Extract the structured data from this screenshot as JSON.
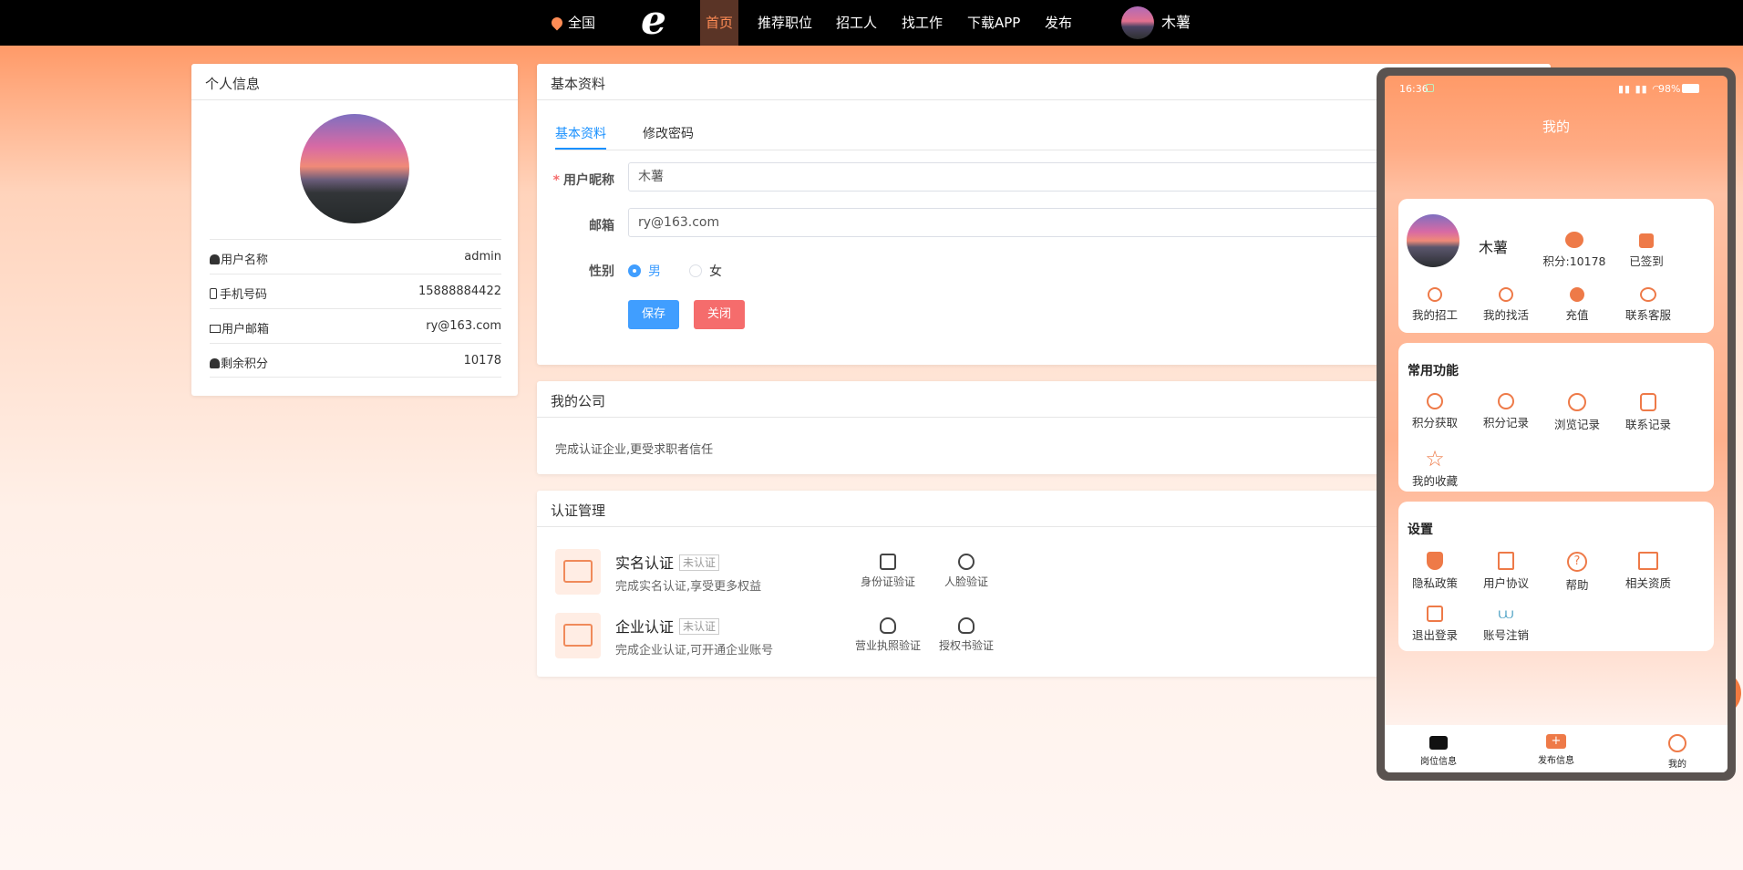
{
  "topnav": {
    "location": "全国",
    "logo": "e",
    "items": [
      "首页",
      "推荐职位",
      "招工人",
      "找工作",
      "下载APP",
      "发布"
    ],
    "active_index": 0,
    "username": "木薯"
  },
  "personal_info": {
    "title": "个人信息",
    "rows": [
      {
        "label": "用户名称",
        "value": "admin",
        "icon": "user-icon"
      },
      {
        "label": "手机号码",
        "value": "15888884422",
        "icon": "phone-icon"
      },
      {
        "label": "用户邮箱",
        "value": "ry@163.com",
        "icon": "mail-icon"
      },
      {
        "label": "剩余积分",
        "value": "10178",
        "icon": "user-icon"
      }
    ]
  },
  "basic_info": {
    "title": "基本资料",
    "tabs": [
      "基本资料",
      "修改密码"
    ],
    "nickname_label": "用户昵称",
    "nickname_value": "木薯",
    "email_label": "邮箱",
    "email_value": "ry@163.com",
    "gender_label": "性别",
    "gender_options": [
      "男",
      "女"
    ],
    "gender_selected": "男",
    "save_label": "保存",
    "close_label": "关闭",
    "save_color": "#409eff",
    "close_color": "#f56c6c"
  },
  "company": {
    "title": "我的公司",
    "text": "完成认证企业,更受求职者信任"
  },
  "cert": {
    "title": "认证管理",
    "items": [
      {
        "name": "实名认证",
        "status": "未认证",
        "desc": "完成实名认证,享受更多权益",
        "actions": [
          "身份证验证",
          "人脸验证"
        ]
      },
      {
        "name": "企业认证",
        "status": "未认证",
        "desc": "完成企业认证,可开通企业账号",
        "actions": [
          "营业执照验证",
          "授权书验证"
        ]
      }
    ]
  },
  "phone": {
    "time": "16:36",
    "battery": "98%",
    "title": "我的",
    "username": "木薯",
    "points_label": "积分:10178",
    "signed_label": "已签到",
    "quick": [
      "我的招工",
      "我的找活",
      "充值",
      "联系客服"
    ],
    "common_title": "常用功能",
    "common": [
      "积分获取",
      "积分记录",
      "浏览记录",
      "联系记录",
      "我的收藏"
    ],
    "settings_title": "设置",
    "settings": [
      "隐私政策",
      "用户协议",
      "帮助",
      "相关资质",
      "退出登录",
      "账号注销"
    ],
    "tabbar": [
      "岗位信息",
      "发布信息",
      "我的"
    ],
    "accent": "#ee7a48"
  }
}
